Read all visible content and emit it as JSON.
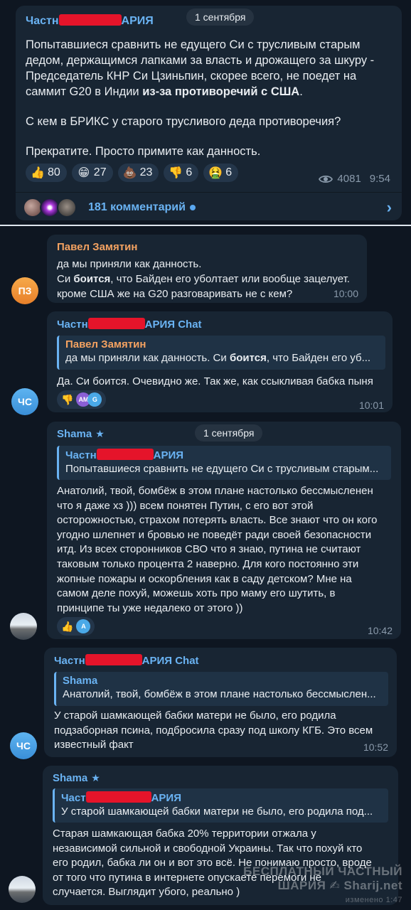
{
  "colors": {
    "background": "#0e1621",
    "bubble": "#182533",
    "accent": "#6ab3f3",
    "redaction": "#e5142a"
  },
  "post": {
    "date": "1 сентября",
    "sender_prefix": "Частн",
    "sender_suffix": "АРИЯ",
    "paragraphs": [
      "Попытавшиеся сравнить не едущего Си с трусливым старым дедом, держащимся лапками за власть и дрожащего за шкуру - Председатель КНР Си Цзиньпин, скорее всего, не поедет на саммит G20 в Индии",
      "С кем в БРИКС у старого трусливого деда противоречия?",
      "Прекратите. Просто примите как данность."
    ],
    "bold_fragment": "из-за противоречий с США",
    "bold_tail": ".",
    "reactions": [
      {
        "icon": "thumbs-up-icon",
        "emoji": "👍",
        "count": "80"
      },
      {
        "icon": "grin-icon",
        "emoji": "😁",
        "count": "27"
      },
      {
        "icon": "poop-icon",
        "emoji": "💩",
        "count": "23"
      },
      {
        "icon": "thumbs-down-icon",
        "emoji": "👎",
        "count": "6"
      },
      {
        "icon": "nauseated-icon",
        "emoji": "🤮",
        "count": "6"
      }
    ],
    "views": "4081",
    "time": "9:54",
    "comments_label": "181 комментарий"
  },
  "messages": {
    "pavel": {
      "author": "Павел Замятин",
      "avatar_initials": "ПЗ",
      "line1": "да мы приняли как данность.",
      "line2_pre": "Си ",
      "line2_bold": "боится",
      "line2_post": ", что Байден его уболтает или вообще зацелует.",
      "line3": "кроме США же на G20 разговаривать не с кем?",
      "time": "10:00"
    },
    "chat1": {
      "author_prefix": "Частн",
      "author_suffix": "АРИЯ Chat",
      "avatar_initials": "ЧС",
      "quote_author": "Павел Замятин",
      "quote_text_pre": "да мы приняли как данность.  Си ",
      "quote_text_bold": "боится",
      "quote_text_post": ", что Байден его уб...",
      "text": "Да. Си боится. Очевидно же. Так же, как ссыкливая бабка пыня",
      "reaction_emoji": "👎",
      "reactor1": "AM",
      "reactor2": "G",
      "time": "10:01"
    },
    "shama1": {
      "date": "1 сентября",
      "author": "Shama",
      "quote_author_prefix": "Частн",
      "quote_author_suffix": "АРИЯ",
      "quote_text": "Попытавшиеся сравнить не едущего Си с трусливым старым...",
      "lines": [
        "Анатолий, твой, бомбёж в этом плане настолько бессмысленен",
        "что я даже хз ))) всем понятен Путин, с его вот этой",
        "осторожностью, страхом потерять власть. Все знают что он кого",
        "угодно шлепнет и бровью не поведёт ради своей безопасности",
        "итд. Из всех сторонников СВО что я знаю, путина не считают",
        "таковым только процента 2 наверно. Для кого постоянно эти",
        "жопные пожары и оскорбления как в саду детском? Мне на",
        "самом деле похуй, можешь хоть про маму его шутить, в",
        "принципе ты уже недалеко от этого ))"
      ],
      "reaction_emoji": "👍",
      "reactor": "A",
      "time": "10:42"
    },
    "chat2": {
      "author_prefix": "Частн",
      "author_suffix": "АРИЯ Chat",
      "avatar_initials": "ЧС",
      "quote_author": "Shama",
      "quote_text": "Анатолий, твой, бомбёж в этом плане настолько бессмыслен...",
      "lines": [
        "У старой шамкающей бабки матери не было, его родила",
        "подзаборная псина, подбросила сразу под школу КГБ. Это всем",
        "известный факт"
      ],
      "time": "10:52"
    },
    "shama2": {
      "author": "Shama",
      "quote_author_prefix": "Част",
      "quote_author_suffix": "АРИЯ",
      "quote_text": "У старой шамкающей бабки матери не было, его родила под...",
      "lines": [
        "Старая шамкающая бабка 20% территории отжала у",
        "независимой сильной и свободной Украины. Так что похуй кто",
        "его родил, бабка ли он и вот это всё. Не понимаю просто, вроде",
        "от того что путина в интернете опускаете перемоги не",
        "случается. Выглядит убого, реально )"
      ]
    }
  },
  "watermark": {
    "line1": "БЕСПЛАТНЫЙ ЧАСТНЫЙ",
    "line2": "ШАРИЯ",
    "line2_site": "Sharij.net",
    "edited": "изменено 1:47"
  }
}
